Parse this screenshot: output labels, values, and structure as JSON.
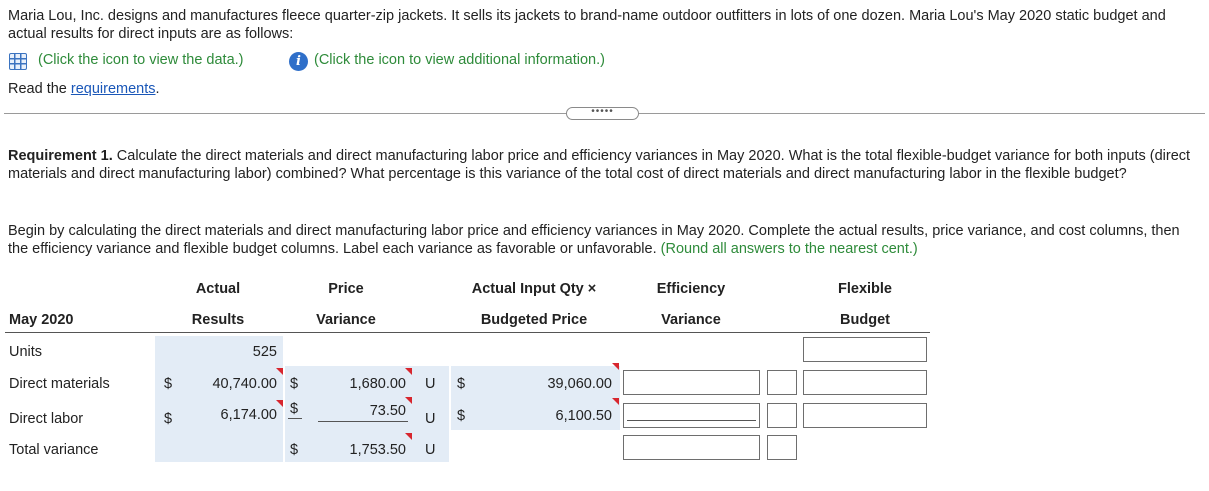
{
  "intro": {
    "paragraph": "Maria Lou, Inc. designs and manufactures fleece quarter-zip jackets. It sells its jackets to brand-name outdoor outfitters in lots of one dozen. Maria Lou's May 2020 static budget and actual results for direct inputs are as follows:",
    "data_link": "(Click the icon to view the data.)",
    "info_link": "(Click the icon to view additional information.)",
    "read_prefix": "Read the ",
    "read_link": "requirements",
    "read_suffix": "."
  },
  "expander_label": "•••••",
  "requirement": {
    "label": "Requirement 1.",
    "text": " Calculate the direct materials and direct manufacturing labor price and efficiency variances in May 2020. What is the total flexible-budget variance for both inputs (direct materials and direct manufacturing labor) combined? What percentage is this variance of the total cost of direct materials and direct manufacturing labor in the flexible budget?"
  },
  "instructions": {
    "text": "Begin by calculating the direct materials and direct manufacturing labor price and efficiency variances in May 2020. Complete the actual results, price variance, and cost columns, then the efficiency variance and flexible budget columns. Label each variance as favorable or unfavorable. ",
    "hint": "(Round all answers to the nearest cent.)"
  },
  "table": {
    "row_header": "May 2020",
    "columns": [
      {
        "line1": "Actual",
        "line2": "Results"
      },
      {
        "line1": "Price",
        "line2": "Variance"
      },
      {
        "line1": "Actual Input Qty ×",
        "line2": "Budgeted Price"
      },
      {
        "line1": "Efficiency",
        "line2": "Variance"
      },
      {
        "line1": "Flexible",
        "line2": "Budget"
      }
    ],
    "rows": {
      "units": {
        "label": "Units",
        "actual": "525"
      },
      "materials": {
        "label": "Direct materials",
        "actual_cur": "$",
        "actual": "40,740.00",
        "price_cur": "$",
        "price": "1,680.00",
        "price_fu": "U",
        "aiq_cur": "$",
        "aiq": "39,060.00"
      },
      "labor": {
        "label": "Direct labor",
        "actual_cur": "$",
        "actual": "6,174.00",
        "price_cur": "$",
        "price": "73.50",
        "price_fu": "U",
        "aiq_cur": "$",
        "aiq": "6,100.50"
      },
      "total": {
        "label": "Total variance",
        "price_cur": "$",
        "price": "1,753.50",
        "price_fu": "U"
      }
    }
  }
}
